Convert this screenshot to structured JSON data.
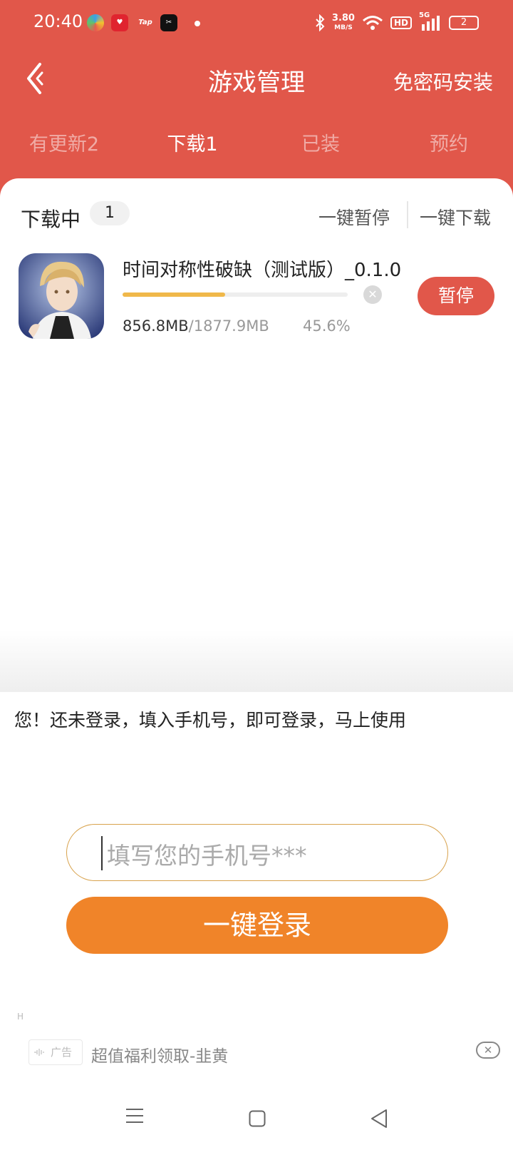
{
  "status_bar": {
    "time": "20:40",
    "apps": [
      {
        "name": "colorful-app-icon",
        "label": "",
        "color": "#3aa0e8"
      },
      {
        "name": "red-app-icon",
        "label": "",
        "color": "#e0242f"
      },
      {
        "name": "tap-app-icon",
        "label": "Tap",
        "color": "#e1574a"
      },
      {
        "name": "capcut-app-icon",
        "label": "",
        "color": "#111111"
      }
    ],
    "speed_value": "3.80",
    "speed_unit": "MB/S",
    "hd_label": "HD",
    "network": "5G",
    "battery": "2"
  },
  "header": {
    "title": "游戏管理",
    "password_free_install": "免密码安装",
    "tabs": [
      {
        "label": "有更新2",
        "active": false
      },
      {
        "label": "下载1",
        "active": true
      },
      {
        "label": "已装",
        "active": false
      },
      {
        "label": "预约",
        "active": false
      }
    ]
  },
  "downloads": {
    "section_title": "下载中",
    "count": "1",
    "pause_all": "一键暂停",
    "download_all": "一键下载",
    "items": [
      {
        "name": "时间对称性破缺（测试版）_0.1.0",
        "downloaded": "856.8MB",
        "total": "/1877.9MB",
        "percent": "45.6%",
        "progress": 0.456,
        "action": "暂停"
      }
    ]
  },
  "login": {
    "message": "您！还未登录，填入手机号，即可登录，马上使用",
    "phone_placeholder": "填写您的手机号***",
    "login_button": "一键登录"
  },
  "ad": {
    "marker": "H",
    "badge": "广告",
    "text": "超值福利领取-韭黄",
    "close": "✕"
  },
  "colors": {
    "brand_red": "#e1574a",
    "login_orange": "#f08429",
    "progress_yellow": "#f0b84a",
    "input_border": "#d8a24c"
  }
}
